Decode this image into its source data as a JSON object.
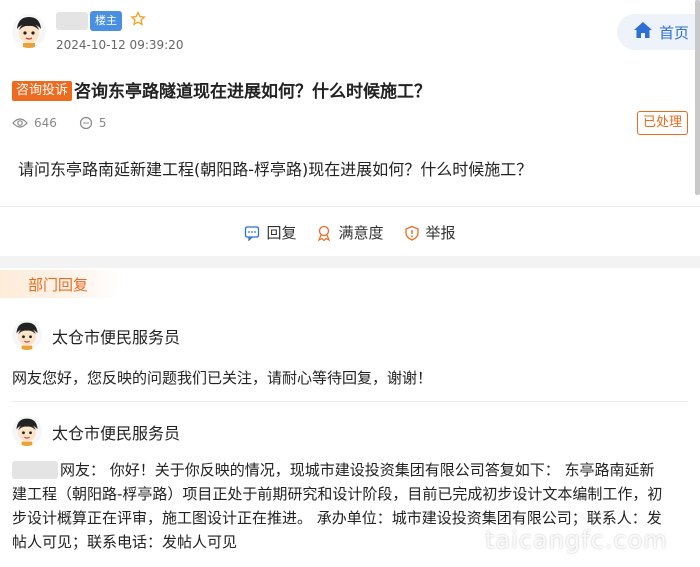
{
  "author": {
    "badge": "楼主",
    "time": "2024-10-12 09:39:20"
  },
  "home_button": {
    "label": "首页"
  },
  "post": {
    "category": "咨询投诉",
    "title": "咨询东亭路隧道现在进展如何？什么时候施工？",
    "views": "646",
    "comments": "5",
    "status": "已处理",
    "content": "请问东亭路南延新建工程(朝阳路-桴亭路)现在进展如何？什么时候施工？"
  },
  "actions": {
    "reply": "回复",
    "satisfaction": "满意度",
    "report": "举报"
  },
  "dept_section": {
    "label": "部门回复"
  },
  "replies": [
    {
      "name": "太仓市便民服务员",
      "text": "网友您好，您反映的问题我们已关注，请耐心等待回复，谢谢！"
    },
    {
      "name": "太仓市便民服务员",
      "line1": "网友：  你好！关于你反映的情况，现城市建设投资集团有限公司答复如下：  东亭路南延新",
      "line2": "建工程（朝阳路-桴亭路）项目正处于前期研究和设计阶段，目前已完成初步设计文本编制工作，初",
      "line3": "步设计概算正在评审，施工图设计正在推进。 承办单位：城市建设投资集团有限公司；联系人：发",
      "line4": "帖人可见；联系电话：发帖人可见"
    }
  ],
  "watermark": "taicangfc.com",
  "colors": {
    "accent": "#ee6a1f",
    "link_blue": "#2d6fd6",
    "badge_blue": "#4a90e2"
  }
}
